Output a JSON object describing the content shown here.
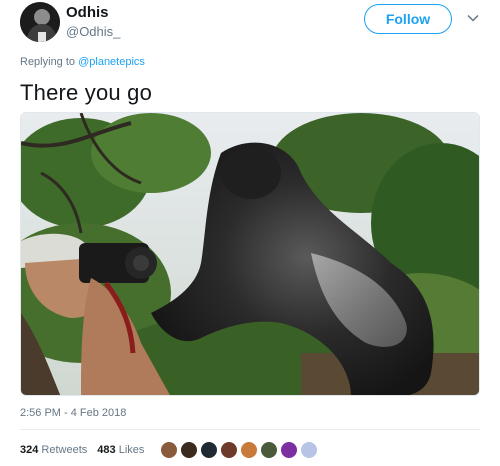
{
  "author": {
    "display_name": "Odhis",
    "handle": "@Odhis_",
    "avatar_icon": "avatar-photo"
  },
  "follow_button": {
    "label": "Follow",
    "color": "#1da1f2"
  },
  "menu_icon": "chevron-down-icon",
  "reply": {
    "prefix": "Replying to ",
    "mention": "@planetepics"
  },
  "tweet": {
    "text": "There you go"
  },
  "photo": {
    "description_icon": "tweet-photo"
  },
  "timestamp": "2:56 PM - 4 Feb 2018",
  "stats": {
    "retweets_count": "324",
    "retweets_label": "Retweets",
    "likes_count": "483",
    "likes_label": "Likes"
  },
  "likers": [
    {
      "color": "#8a5a3c"
    },
    {
      "color": "#3b2a1e"
    },
    {
      "color": "#1f2a33"
    },
    {
      "color": "#6e3b2a"
    },
    {
      "color": "#c77a3a"
    },
    {
      "color": "#4a5b3a"
    },
    {
      "color": "#7b2fa0"
    },
    {
      "color": "#b8c4e6"
    }
  ],
  "colors": {
    "accent": "#1da1f2",
    "secondary_text": "#657786",
    "primary_text": "#14171a"
  }
}
